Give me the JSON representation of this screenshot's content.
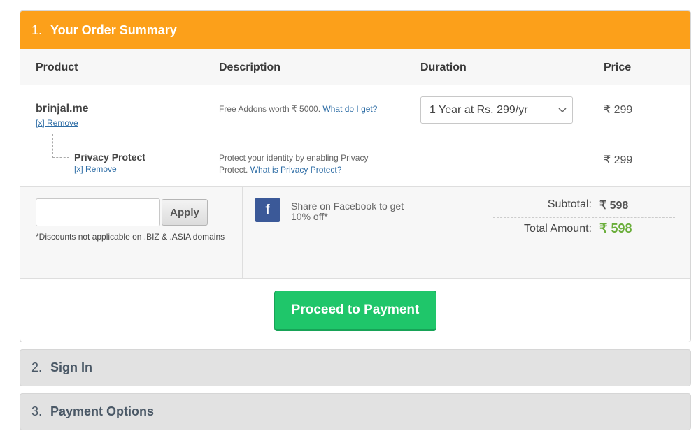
{
  "step1": {
    "number": "1.",
    "title": "Your Order Summary"
  },
  "table": {
    "headers": {
      "product": "Product",
      "description": "Description",
      "duration": "Duration",
      "price": "Price"
    },
    "item": {
      "name": "brinjal.me",
      "remove": "[x] Remove",
      "description": "Free Addons worth ₹ 5000. ",
      "description_link": "What do I get?",
      "duration_selected": "1 Year at Rs. 299/yr",
      "price": "₹ 299"
    },
    "addon": {
      "name": "Privacy Protect",
      "remove": "[x] Remove",
      "description": "Protect your identity by enabling Privacy Protect. ",
      "description_link": "What is Privacy Protect?",
      "price": "₹ 299"
    }
  },
  "coupon": {
    "input_value": "",
    "input_placeholder": "",
    "apply_label": "Apply",
    "note": "*Discounts not applicable on .BIZ & .ASIA domains"
  },
  "facebook": {
    "icon": "facebook-icon",
    "text": "Share on Facebook to get 10% off*"
  },
  "summary": {
    "subtotal_label": "Subtotal:",
    "subtotal_value": "₹ 598",
    "total_label": "Total Amount:",
    "total_value": "₹ 598"
  },
  "proceed_label": "Proceed to Payment",
  "step2": {
    "number": "2.",
    "title": "Sign In"
  },
  "step3": {
    "number": "3.",
    "title": "Payment Options"
  },
  "colors": {
    "accent": "#fca01a",
    "proceed": "#1fc66a",
    "total": "#6aae3a",
    "facebook": "#3b5998"
  }
}
